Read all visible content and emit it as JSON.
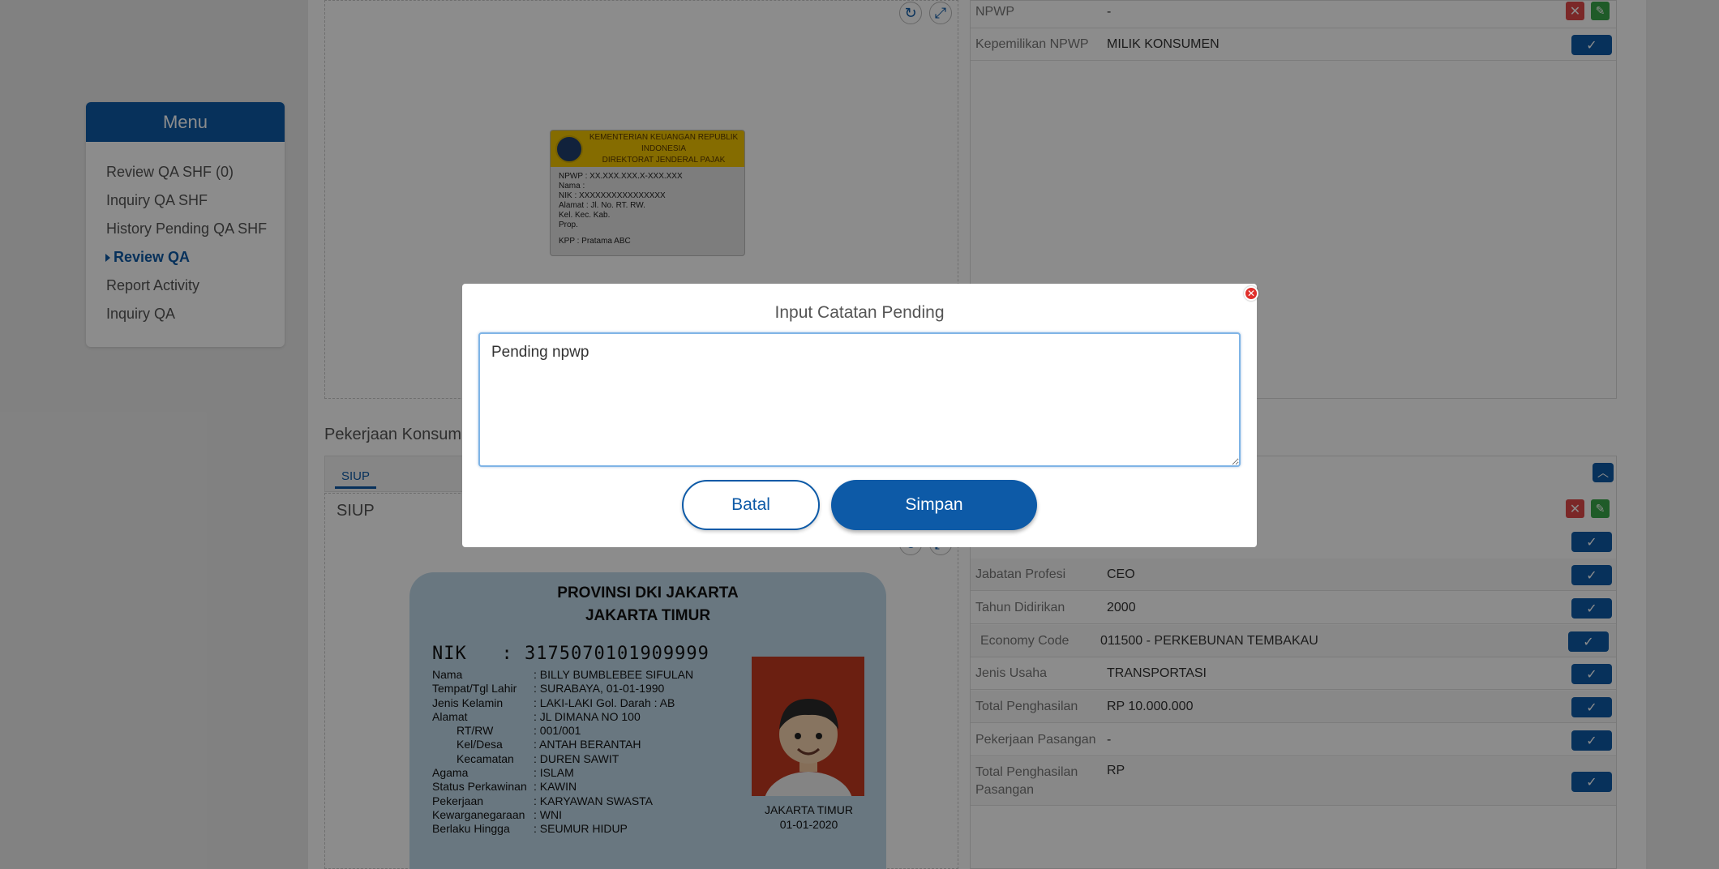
{
  "menu": {
    "title": "Menu",
    "items": [
      {
        "label": "Review QA SHF (0)"
      },
      {
        "label": "Inquiry QA SHF"
      },
      {
        "label": "History Pending QA SHF"
      },
      {
        "label": "Review QA",
        "active": true
      },
      {
        "label": "Report Activity"
      },
      {
        "label": "Inquiry QA"
      }
    ]
  },
  "npwp_section": {
    "rows": [
      {
        "label": "NPWP",
        "value": "-"
      },
      {
        "label": "Kepemilikan NPWP",
        "value": "MILIK KONSUMEN"
      }
    ],
    "card": {
      "header_line1": "KEMENTERIAN KEUANGAN REPUBLIK INDONESIA",
      "header_line2": "DIREKTORAT JENDERAL PAJAK",
      "npwp": "NPWP  :  XX.XXX.XXX.X-XXX.XXX",
      "nama": "Nama  :",
      "nik": "NIK   :  XXXXXXXXXXXXXXXX",
      "alamat": "Alamat : Jl.        No.    RT.  RW.",
      "kel": "Kel.          Kec.          Kab.",
      "prop": "Prop.",
      "kpp": "KPP   :  Pratama ABC"
    }
  },
  "pekerjaan_section": {
    "title": "Pekerjaan Konsum",
    "tab": "SIUP",
    "doc_title": "SIUP",
    "rows": [
      {
        "label": "Jabatan Profesi",
        "value": "CEO"
      },
      {
        "label": "Tahun Didirikan",
        "value": "2000"
      },
      {
        "label": "Economy Code",
        "value": "011500 - PERKEBUNAN TEMBAKAU"
      },
      {
        "label": "Jenis Usaha",
        "value": "TRANSPORTASI"
      },
      {
        "label": "Total Penghasilan",
        "value": "RP 10.000.000"
      },
      {
        "label": "Pekerjaan Pasangan",
        "value": "-"
      },
      {
        "label": "Total Penghasilan Pasangan",
        "value": "RP"
      }
    ]
  },
  "ktp": {
    "province": "PROVINSI DKI JAKARTA",
    "city": "JAKARTA TIMUR",
    "nik_label": "NIK",
    "nik_value": ": 3175070101909999",
    "fields": [
      {
        "k": "Nama",
        "v": ": BILLY BUMBLEBEE SIFULAN"
      },
      {
        "k": "Tempat/Tgl Lahir",
        "v": ": SURABAYA, 01-01-1990"
      },
      {
        "k": "Jenis Kelamin",
        "v": ": LAKI-LAKI        Gol. Darah : AB"
      },
      {
        "k": "Alamat",
        "v": ": JL DIMANA NO 100"
      },
      {
        "k": "    RT/RW",
        "v": ": 001/001"
      },
      {
        "k": "    Kel/Desa",
        "v": ": ANTAH BERANTAH"
      },
      {
        "k": "    Kecamatan",
        "v": ": DUREN SAWIT"
      },
      {
        "k": "Agama",
        "v": ": ISLAM"
      },
      {
        "k": "Status Perkawinan",
        "v": ": KAWIN"
      },
      {
        "k": "Pekerjaan",
        "v": ": KARYAWAN SWASTA"
      },
      {
        "k": "Kewarganegaraan",
        "v": ": WNI"
      },
      {
        "k": "Berlaku Hingga",
        "v": ": SEUMUR HIDUP"
      }
    ],
    "place": "JAKARTA TIMUR",
    "date": "01-01-2020"
  },
  "dialog": {
    "title": "Input Catatan Pending",
    "textarea_value": "Pending npwp",
    "cancel_label": "Batal",
    "save_label": "Simpan"
  },
  "colors": {
    "primary": "#0d5aa7",
    "danger": "#e04a4a",
    "success": "#3aa64a"
  }
}
